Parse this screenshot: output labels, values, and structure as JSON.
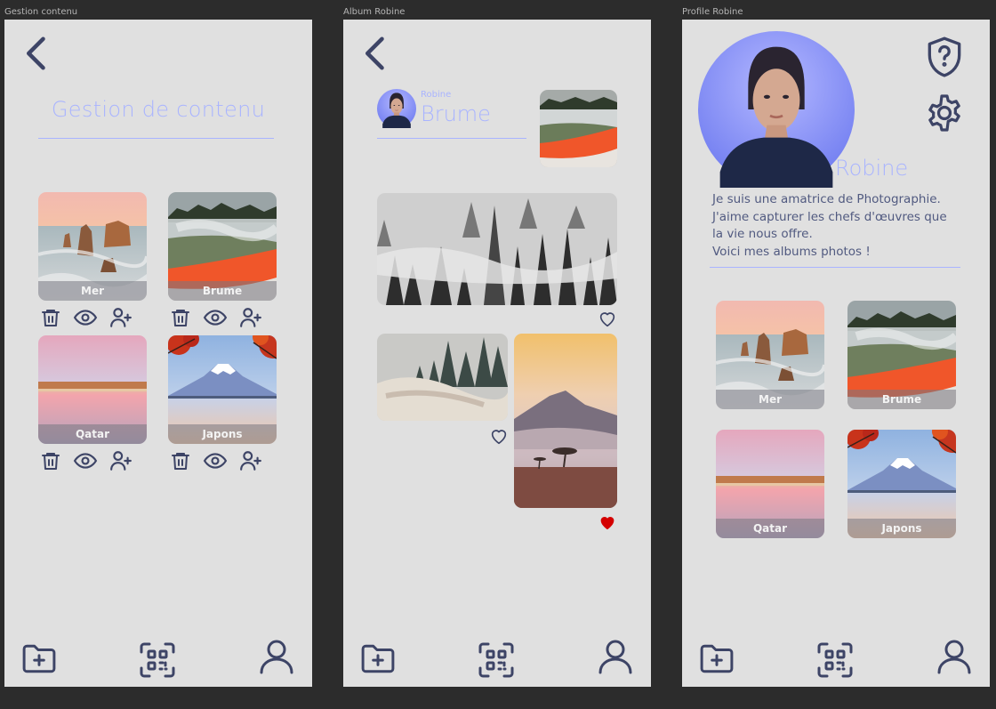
{
  "frames": {
    "gestion": {
      "label": "Gestion contenu"
    },
    "album": {
      "label": "Album Robine"
    },
    "profile": {
      "label": "Profile Robine"
    }
  },
  "gestion": {
    "title": "Gestion de contenu",
    "albums": [
      {
        "label": "Mer"
      },
      {
        "label": "Brume"
      },
      {
        "label": "Qatar"
      },
      {
        "label": "Japons"
      }
    ]
  },
  "album": {
    "owner_name": "Robine",
    "album_title": "Brume",
    "likes": [
      {
        "liked": false
      },
      {
        "liked": false
      },
      {
        "liked": true
      }
    ]
  },
  "profile": {
    "name": "Robine",
    "bio_lines": [
      "Je suis une amatrice de Photographie.",
      "J'aime capturer les chefs d'œuvres que",
      "la vie nous offre.",
      "Voici mes albums photos !"
    ],
    "albums": [
      {
        "label": "Mer"
      },
      {
        "label": "Brume"
      },
      {
        "label": "Qatar"
      },
      {
        "label": "Japons"
      }
    ]
  },
  "icons": {
    "back": "chevron-left-icon",
    "delete": "trash-icon",
    "view": "eye-icon",
    "share": "user-plus-icon",
    "like": "heart-icon",
    "help": "shield-question-icon",
    "settings": "gear-icon",
    "nav_add": "folder-plus-icon",
    "nav_qr": "qr-scan-icon",
    "nav_profile": "user-icon"
  },
  "colors": {
    "background": "#2c2c2c",
    "screen": "#e0e0e0",
    "ink": "#3d4466",
    "accent": "#a9b4ff",
    "liked": "#d40000"
  }
}
